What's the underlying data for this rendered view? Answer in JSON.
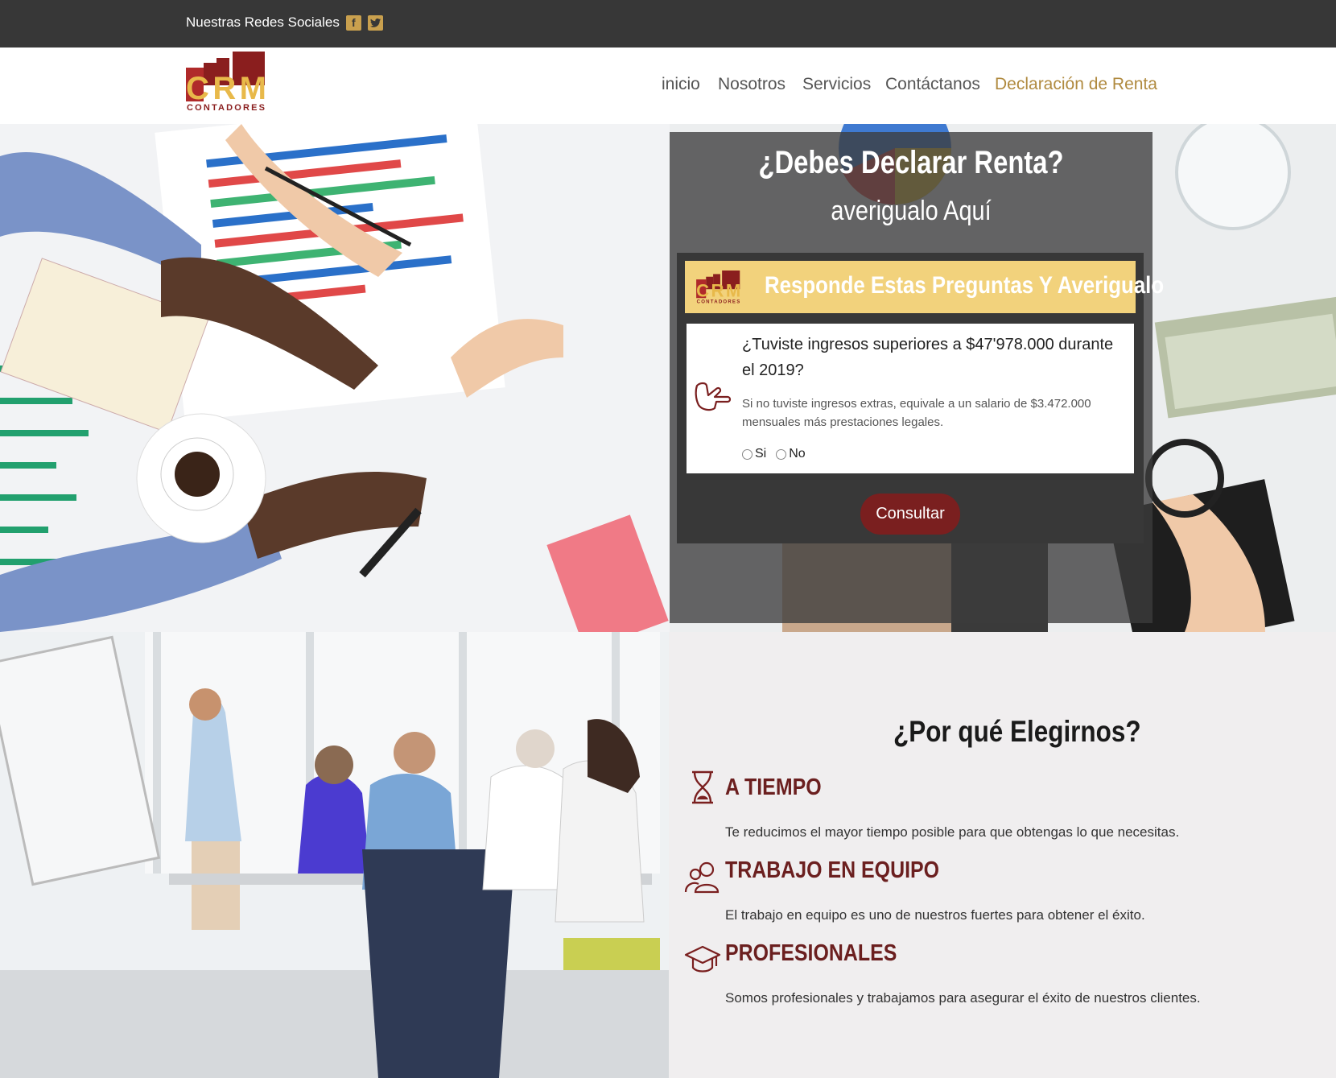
{
  "topbar": {
    "social_label": "Nuestras Redes Sociales",
    "icons": [
      "facebook-icon",
      "twitter-icon"
    ]
  },
  "logo": {
    "letters": "CRM",
    "subtitle": "CONTADORES"
  },
  "nav": {
    "items": [
      {
        "label": "inicio"
      },
      {
        "label": "Nosotros"
      },
      {
        "label": "Servicios"
      },
      {
        "label": "Contáctanos"
      },
      {
        "label": "Declaración de Renta",
        "active": true
      }
    ]
  },
  "hero": {
    "title": "¿Debes Declarar Renta?",
    "subtitle": "averigualo Aquí",
    "quiz": {
      "header": "Responde Estas Preguntas Y Averigualo",
      "question": "¿Tuviste ingresos superiores a $47'978.000 durante el 2019?",
      "hint": "Si no tuviste ingresos extras, equivale a un salario de $3.472.000 mensuales más prestaciones legales.",
      "options": [
        "Si",
        "No"
      ],
      "button": "Consultar"
    }
  },
  "why": {
    "title": "¿Por qué Elegirnos?",
    "features": [
      {
        "title": "A TIEMPO",
        "text": "Te reducimos el mayor tiempo posible para que obtengas lo que necesitas.",
        "icon": "hourglass-icon"
      },
      {
        "title": "TRABAJO EN EQUIPO",
        "text": "El trabajo en equipo es uno de nuestros fuertes para obtener el éxito.",
        "icon": "team-icon"
      },
      {
        "title": "PROFESIONALES",
        "text": "Somos profesionales y trabajamos para asegurar el éxito de nuestros clientes.",
        "icon": "graduation-cap-icon"
      }
    ]
  },
  "colors": {
    "accent": "#b08a3f",
    "brand_red": "#7a1f1f",
    "topbar": "#373737",
    "quiz_header": "#f2d27c"
  }
}
